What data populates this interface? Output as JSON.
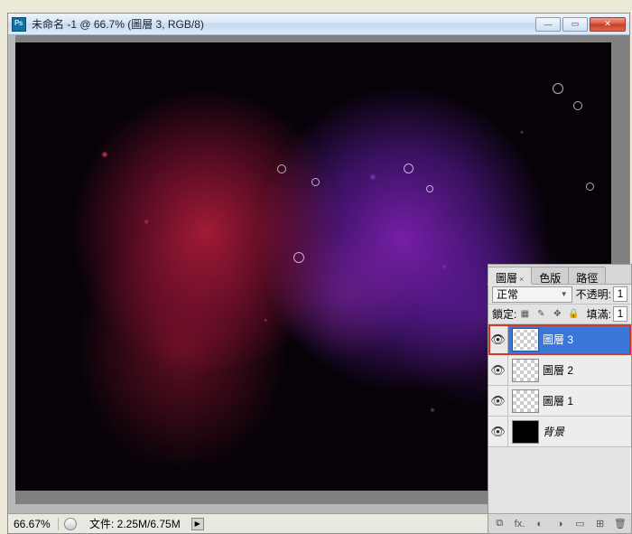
{
  "window": {
    "title": "未命名 -1 @ 66.7% (圖層 3, RGB/8)"
  },
  "status": {
    "zoom": "66.67%",
    "doc_info": "文件: 2.25M/6.75M"
  },
  "panel": {
    "tabs": {
      "layers": "圖層",
      "channels": "色版",
      "paths": "路徑"
    },
    "blend_mode": "正常",
    "opacity_label": "不透明:",
    "opacity_value": "1",
    "lock_label": "鎖定:",
    "fill_label": "填滿:",
    "fill_value": "1",
    "layers": [
      {
        "name": "圖層 3",
        "thumb": "checker",
        "selected": true,
        "italic": false
      },
      {
        "name": "圖層 2",
        "thumb": "checker",
        "selected": false,
        "italic": false
      },
      {
        "name": "圖層 1",
        "thumb": "checker",
        "selected": false,
        "italic": false
      },
      {
        "name": "背景",
        "thumb": "black",
        "selected": false,
        "italic": true
      }
    ],
    "foot_icons": {
      "link": "⌘",
      "fx": "fx.",
      "mask": "◐",
      "adjust": "◑",
      "group": "▭",
      "new": "⧉",
      "trash": "🗑"
    }
  }
}
